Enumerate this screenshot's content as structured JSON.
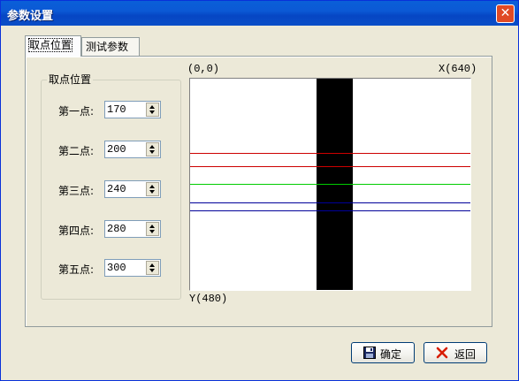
{
  "window": {
    "title": "参数设置",
    "close_label": "✕"
  },
  "tabs": [
    {
      "label": "取点位置",
      "active": true
    },
    {
      "label": "测试参数",
      "active": false
    }
  ],
  "group": {
    "title": "取点位置",
    "rows": [
      {
        "label": "第一点:",
        "value": "170"
      },
      {
        "label": "第二点:",
        "value": "200"
      },
      {
        "label": "第三点:",
        "value": "240"
      },
      {
        "label": "第四点:",
        "value": "280"
      },
      {
        "label": "第五点:",
        "value": "300"
      }
    ]
  },
  "preview": {
    "origin_label": "(0,0)",
    "x_label": "X(640)",
    "y_label": "Y(480)",
    "line_colors": [
      "#cc0000",
      "#cc0000",
      "#00cc00",
      "#000099",
      "#000099"
    ]
  },
  "buttons": {
    "ok_label": "确定",
    "back_label": "返回"
  },
  "colors": {
    "titlebar": "#0a5fd8",
    "dialog_bg": "#ece9d8",
    "stripe": "#000000"
  }
}
